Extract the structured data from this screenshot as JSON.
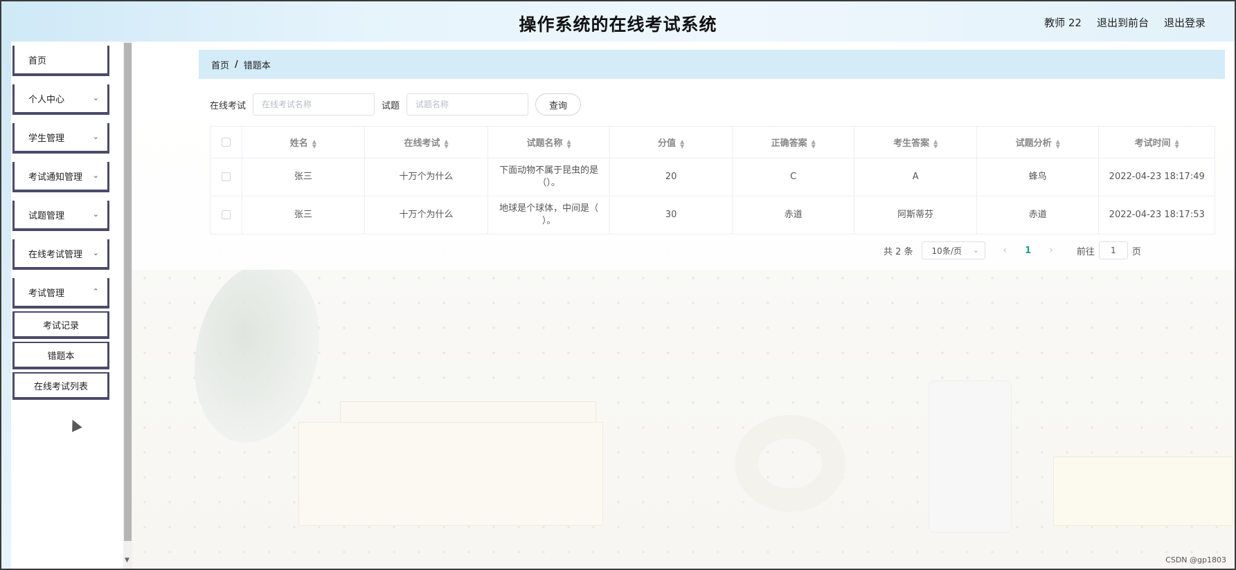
{
  "header": {
    "title": "操作系统的在线考试系统",
    "user": "教师 22",
    "back_to_front": "退出到前台",
    "logout": "退出登录"
  },
  "sidebar": {
    "items": [
      {
        "label": "首页"
      },
      {
        "label": "个人中心"
      },
      {
        "label": "学生管理"
      },
      {
        "label": "考试通知管理"
      },
      {
        "label": "试题管理"
      },
      {
        "label": "在线考试管理"
      },
      {
        "label": "考试管理"
      }
    ],
    "subitems": [
      {
        "label": "考试记录"
      },
      {
        "label": "错题本"
      },
      {
        "label": "在线考试列表"
      }
    ]
  },
  "breadcrumb": {
    "home": "首页",
    "sep": "/",
    "current": "错题本"
  },
  "filter": {
    "exam_label": "在线考试",
    "exam_placeholder": "在线考试名称",
    "question_label": "试题",
    "question_placeholder": "试题名称",
    "query": "查询"
  },
  "table": {
    "columns": [
      "姓名",
      "在线考试",
      "试题名称",
      "分值",
      "正确答案",
      "考生答案",
      "试题分析",
      "考试时间"
    ],
    "rows": [
      [
        "张三",
        "十万个为什么",
        "下面动物不属于昆虫的是（）。",
        "20",
        "C",
        "A",
        "蜂鸟",
        "2022-04-23 18:17:49"
      ],
      [
        "张三",
        "十万个为什么",
        "地球是个球体，中间是（ ）。",
        "30",
        "赤道",
        "阿斯蒂芬",
        "赤道",
        "2022-04-23 18:17:53"
      ]
    ]
  },
  "pagination": {
    "total": "共 2 条",
    "page_size": "10条/页",
    "current": "1",
    "goto_label": "前往",
    "goto_value": "1",
    "page_unit": "页"
  },
  "watermark": "CSDN @gp1803"
}
